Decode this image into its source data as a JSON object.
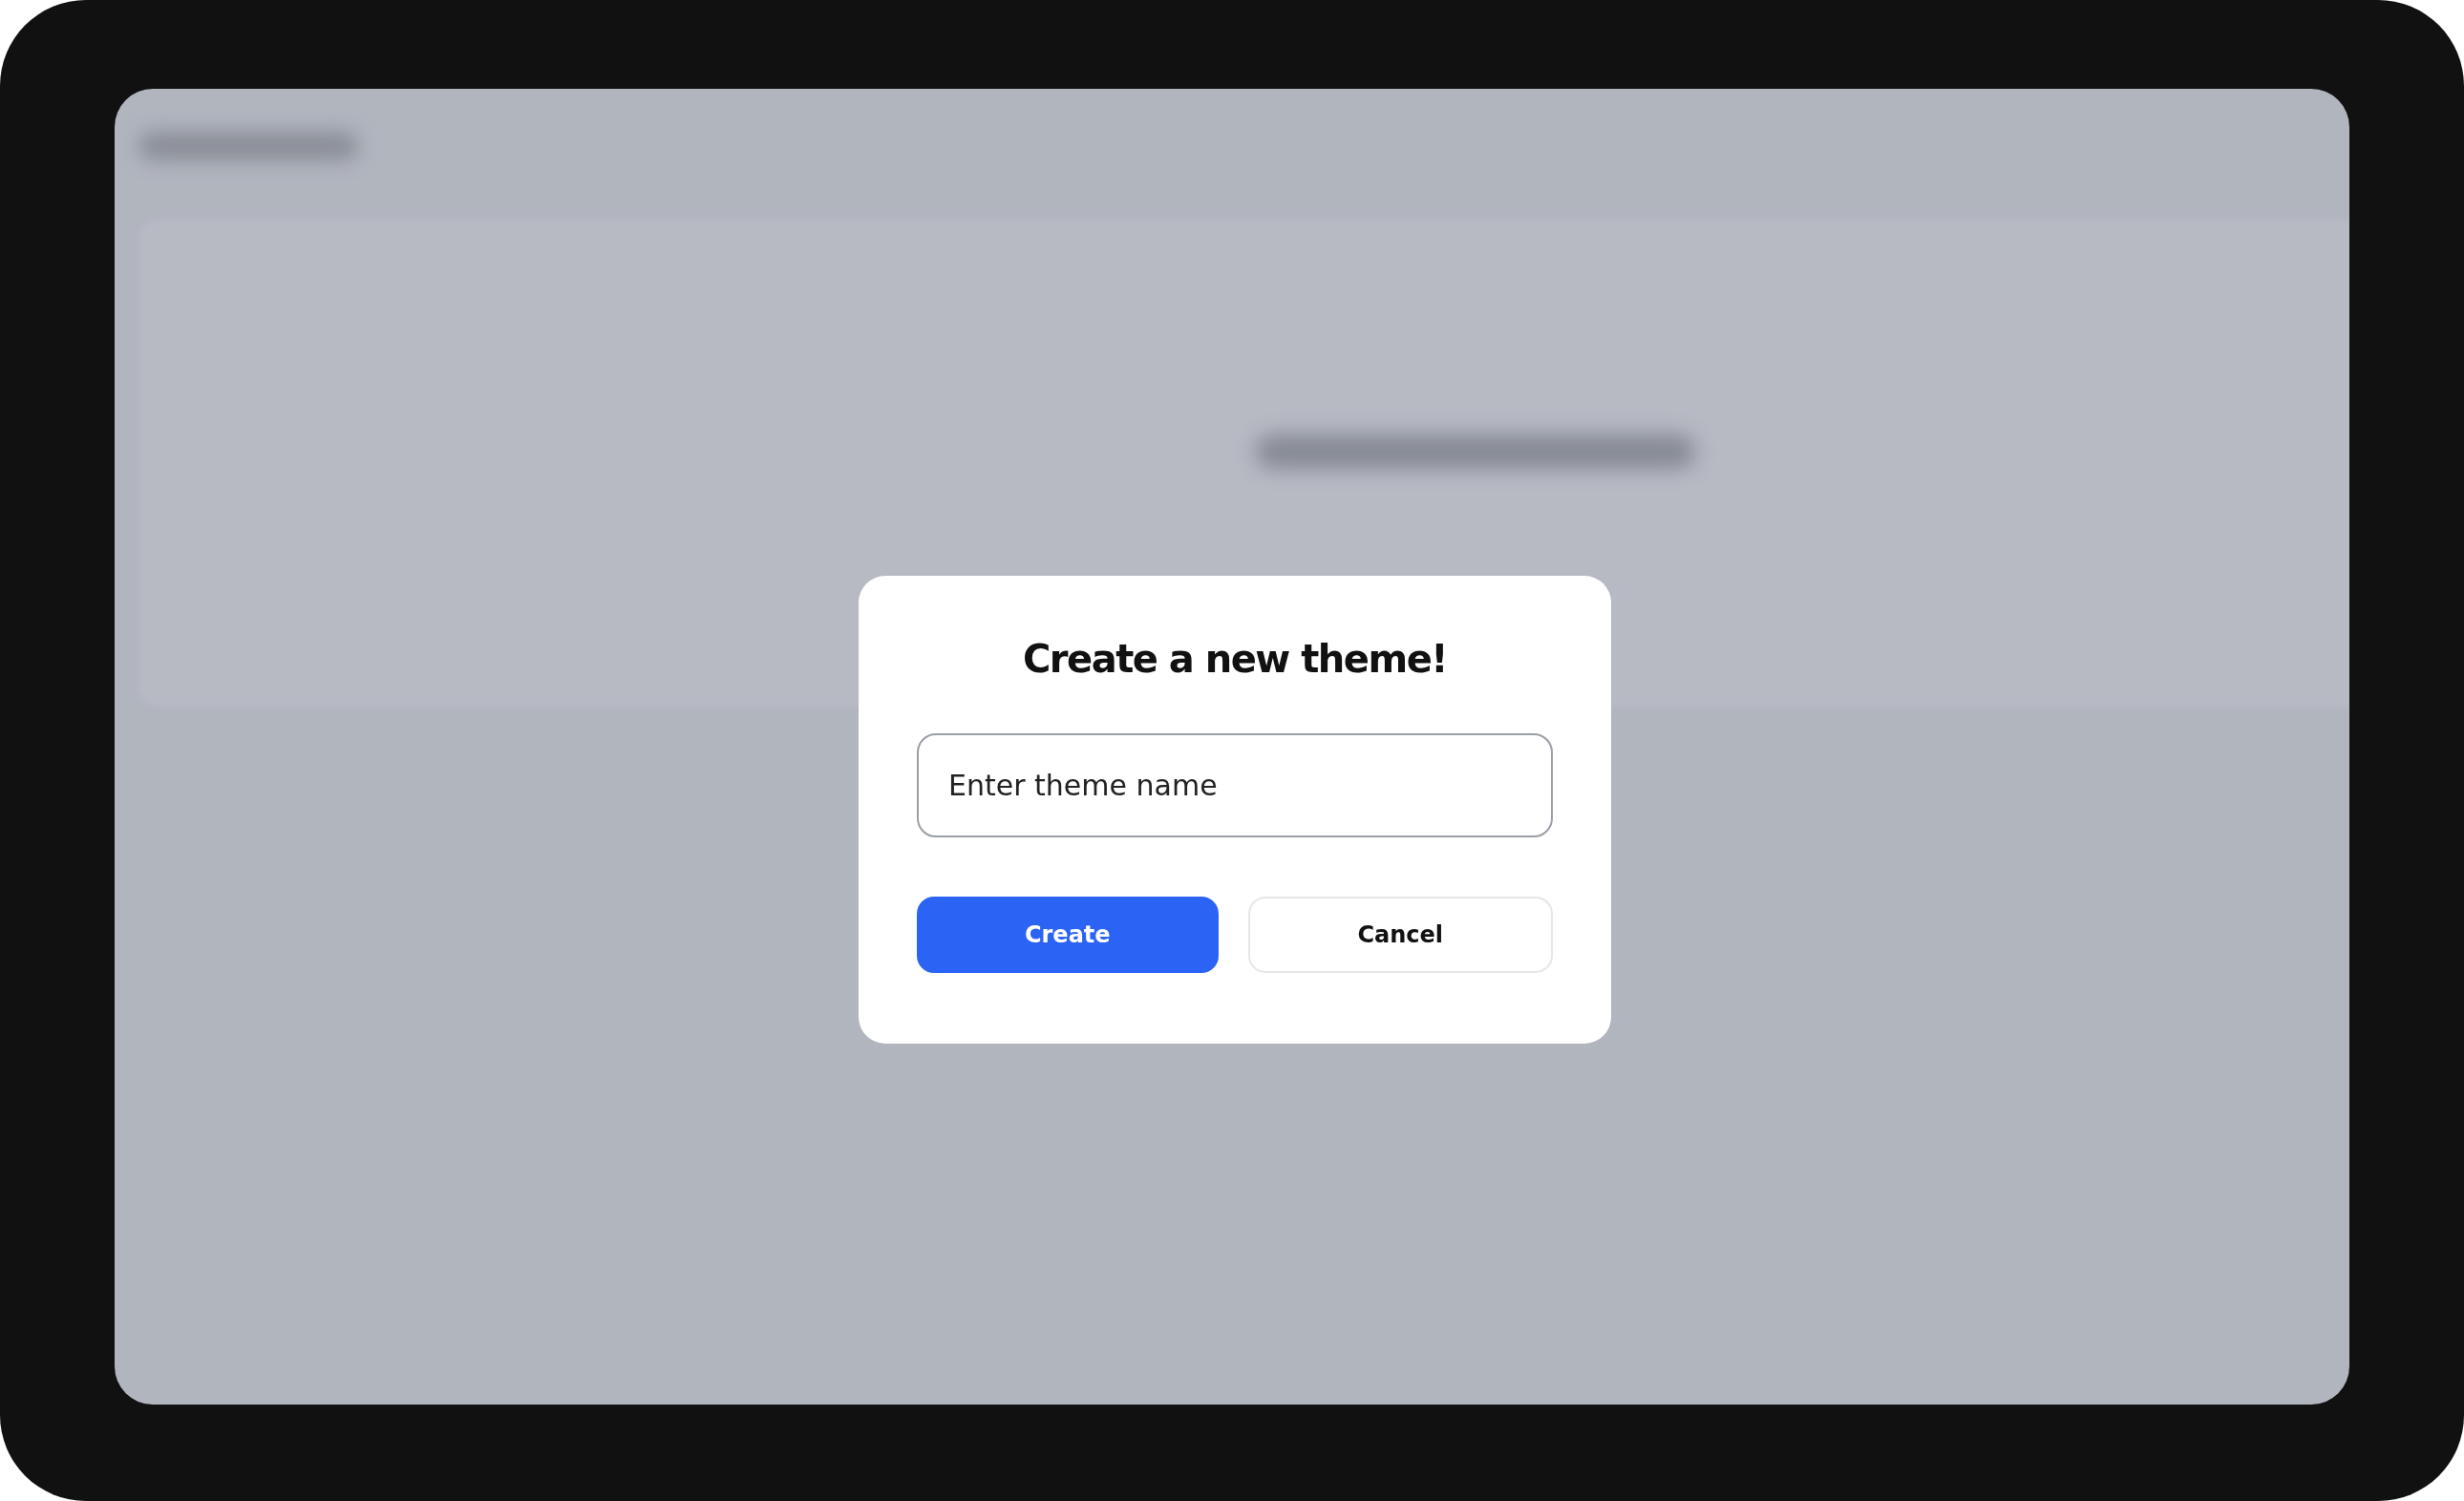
{
  "dialog": {
    "title": "Create a new theme!",
    "input": {
      "placeholder": "Enter theme name"
    },
    "buttons": [
      {
        "label": "Create",
        "kind": "primary"
      },
      {
        "label": "Cancel",
        "kind": "secondary"
      }
    ]
  }
}
